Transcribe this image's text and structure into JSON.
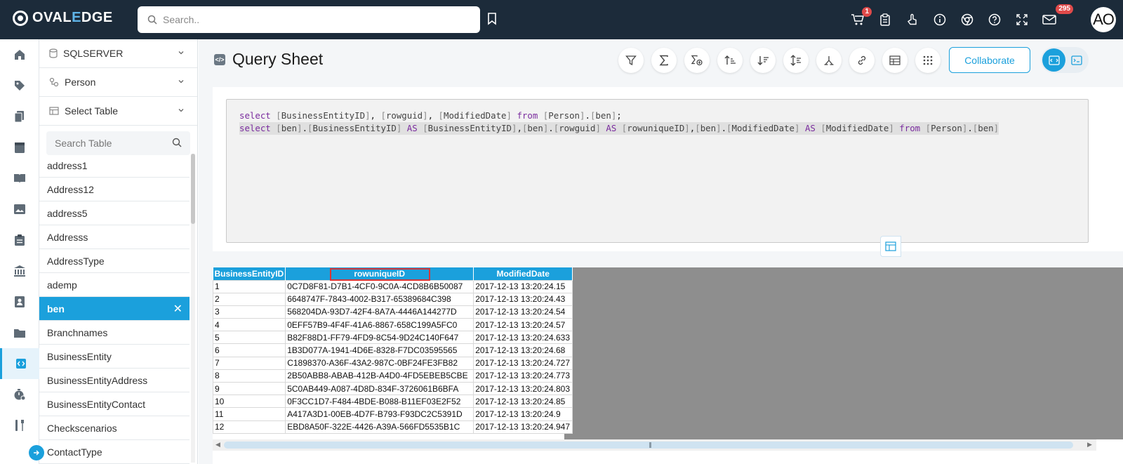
{
  "app": {
    "logo_prefix": "OVAL",
    "logo_accent": "E",
    "logo_suffix": "DGE",
    "search_placeholder": "Search..",
    "notifications": {
      "cart_badge": "1",
      "mail_badge": "295"
    },
    "avatar_initials": "AO",
    "accent_color": "#1ba0dc",
    "topbar_color": "#1c2b3a"
  },
  "nav": {
    "icons": [
      "home-icon",
      "tag-icon",
      "documents-icon",
      "database-icon",
      "book-icon",
      "image-report-icon",
      "clipboard-icon",
      "bank-icon",
      "contacts-icon",
      "folder-icon",
      "query-icon",
      "stopwatch-icon",
      "tools-icon"
    ],
    "active": "query-icon"
  },
  "sidebar": {
    "connection": "SQLSERVER",
    "schema": "Person",
    "table_select": "Select Table",
    "search_placeholder": "Search Table",
    "tables": [
      "address1",
      "Address12",
      "address5",
      "Addresss",
      "AddressType",
      "ademp",
      "ben",
      "Branchnames",
      "BusinessEntity",
      "BusinessEntityAddress",
      "BusinessEntityContact",
      "Checkscenarios",
      "ContactType"
    ],
    "selected_table": "ben"
  },
  "main": {
    "title": "Query Sheet",
    "toolbar_icons": [
      "filter-icon",
      "sigma-icon",
      "formula-icon",
      "sort-asc-icon",
      "sort-desc-icon",
      "sort-icon",
      "join-icon",
      "link-icon",
      "table-icon",
      "grid-dots-icon"
    ],
    "collaborate_label": "Collaborate",
    "query_lines": [
      "select [BusinessEntityID], [rowguid], [ModifiedDate] from [Person].[ben];",
      "select [ben].[BusinessEntityID] AS [BusinessEntityID],[ben].[rowguid] AS [rowuniqueID],[ben].[ModifiedDate] AS [ModifiedDate] from [Person].[ben]"
    ]
  },
  "results": {
    "columns": [
      "BusinessEntityID",
      "rowuniqueID",
      "ModifiedDate"
    ],
    "highlighted_column": "rowuniqueID",
    "rows": [
      [
        "1",
        "0C7D8F81-D7B1-4CF0-9C0A-4CD8B6B50087",
        "2017-12-13 13:20:24.15"
      ],
      [
        "2",
        "6648747F-7843-4002-B317-65389684C398",
        "2017-12-13 13:20:24.43"
      ],
      [
        "3",
        "568204DA-93D7-42F4-8A7A-4446A144277D",
        "2017-12-13 13:20:24.54"
      ],
      [
        "4",
        "0EFF57B9-4F4F-41A6-8867-658C199A5FC0",
        "2017-12-13 13:20:24.57"
      ],
      [
        "5",
        "B82F88D1-FF79-4FD9-8C54-9D24C140F647",
        "2017-12-13 13:20:24.633"
      ],
      [
        "6",
        "1B3D077A-1941-4D6E-8328-F7DC03595565",
        "2017-12-13 13:20:24.68"
      ],
      [
        "7",
        "C1898370-A36F-43A2-987C-0BF24FE3FB82",
        "2017-12-13 13:20:24.727"
      ],
      [
        "8",
        "2B50ABB8-ABAB-412B-A4D0-4FD5EBEB5CBE",
        "2017-12-13 13:20:24.773"
      ],
      [
        "9",
        "5C0AB449-A087-4D8D-834F-3726061B6BFA",
        "2017-12-13 13:20:24.803"
      ],
      [
        "10",
        "0F3CC1D7-F484-4BDE-B088-B11EF03E2F52",
        "2017-12-13 13:20:24.85"
      ],
      [
        "11",
        "A417A3D1-00EB-4D7F-B793-F93DC2C5391D",
        "2017-12-13 13:20:24.9"
      ],
      [
        "12",
        "EBD8A50F-322E-4426-A39A-566FD5535B1C",
        "2017-12-13 13:20:24.947"
      ]
    ]
  }
}
